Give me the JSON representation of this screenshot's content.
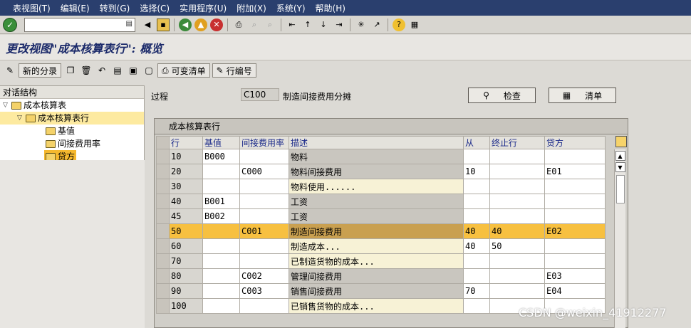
{
  "menubar": {
    "items": [
      "表视图(T)",
      "编辑(E)",
      "转到(G)",
      "选择(C)",
      "实用程序(U)",
      "附加(X)",
      "系统(Y)",
      "帮助(H)"
    ]
  },
  "stdbar": {
    "command_value": ""
  },
  "title": "更改视图\"成本核算表行\": 概览",
  "apptoolbar": {
    "new_entries": "新的分录",
    "variable_list": "可变清单",
    "line_number": "行编号"
  },
  "tree": {
    "header": "对话结构",
    "nodes": [
      {
        "label": "成本核算表",
        "level": 0
      },
      {
        "label": "成本核算表行",
        "level": 1
      },
      {
        "label": "基值",
        "level": 2
      },
      {
        "label": "间接费用率",
        "level": 2
      },
      {
        "label": "贷方",
        "level": 2
      }
    ]
  },
  "header_fields": {
    "process_label": "过程",
    "process_value": "C100",
    "process_desc": "制造间接费用分摊",
    "check_button": "检查",
    "list_button": "清单"
  },
  "table": {
    "title": "成本核算表行",
    "columns": [
      "行",
      "基值",
      "间接费用率",
      "描述",
      "从",
      "终止行",
      "贷方"
    ],
    "rows": [
      [
        "10",
        "B000",
        "",
        "物料",
        "",
        "",
        ""
      ],
      [
        "20",
        "",
        "C000",
        "物料间接费用",
        "10",
        "",
        "E01"
      ],
      [
        "30",
        "",
        "",
        "物料使用......",
        "",
        "",
        ""
      ],
      [
        "40",
        "B001",
        "",
        "工资",
        "",
        "",
        ""
      ],
      [
        "45",
        "B002",
        "",
        "工资",
        "",
        "",
        ""
      ],
      [
        "50",
        "",
        "C001",
        "制造间接费用",
        "40",
        "40",
        "E02"
      ],
      [
        "60",
        "",
        "",
        "制造成本...",
        "40",
        "50",
        ""
      ],
      [
        "70",
        "",
        "",
        "已制造货物的成本...",
        "",
        "",
        ""
      ],
      [
        "80",
        "",
        "C002",
        "管理间接费用",
        "",
        "",
        "E03"
      ],
      [
        "90",
        "",
        "C003",
        "销售间接费用",
        "70",
        "",
        "E04"
      ],
      [
        "100",
        "",
        "",
        "已销售货物的成本...",
        "",
        "",
        ""
      ]
    ],
    "highlighted_row": "50"
  },
  "watermark": "CSDN @weixin_41912277",
  "colors": {
    "menubar_bg": "#2a3f6e",
    "highlight_row": "#f7c040",
    "title_text": "#1b2a6a"
  }
}
